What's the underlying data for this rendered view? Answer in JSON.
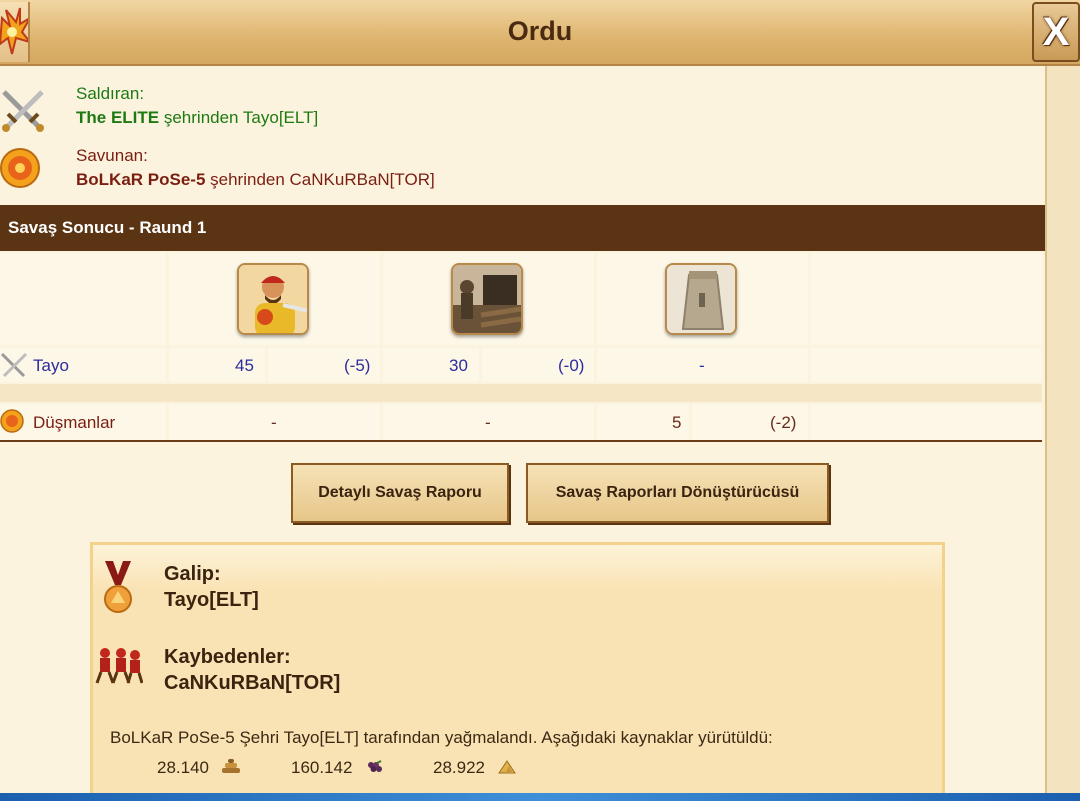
{
  "window": {
    "title": "Ordu",
    "close_label": "X"
  },
  "attacker": {
    "label": "Saldıran:",
    "city": "The ELITE",
    "from_text": " şehrinden Tayo[ELT]"
  },
  "defender": {
    "label": "Savunan:",
    "city": "BoLKaR PoSe-5",
    "from_text": " şehrinden CaNKuRBaN[TOR]"
  },
  "battle": {
    "section_title": "Savaş Sonucu - Raund 1",
    "units": [
      {
        "icon": "slinger-unit-icon"
      },
      {
        "icon": "catapult-unit-icon"
      },
      {
        "icon": "wall-tower-icon"
      }
    ],
    "rows": [
      {
        "name": "Tayo",
        "icon": "crossed-swords-icon",
        "unit1": {
          "count": "45",
          "loss": "(-5)"
        },
        "unit2": {
          "count": "30",
          "loss": "(-0)"
        },
        "unit3": {
          "count": "-"
        }
      },
      {
        "name": "Düşmanlar",
        "icon": "shield-icon",
        "unit1": {
          "count": "-"
        },
        "unit2": {
          "count": "-"
        },
        "unit3": {
          "count": "5",
          "loss": "(-2)"
        }
      }
    ]
  },
  "buttons": {
    "detailed_report": "Detaylı Savaş Raporu",
    "report_converter": "Savaş Raporları Dönüştürücüsü"
  },
  "result": {
    "winner_label": "Galip:",
    "winner_name": "Tayo[ELT]",
    "losers_label": "Kaybedenler:",
    "losers_name": "CaNKuRBaN[TOR]",
    "plunder_text": "BoLKaR PoSe-5 Şehri Tayo[ELT] tarafından yağmalandı. Aşağıdaki kaynaklar yürütüldü:",
    "resources": [
      {
        "amount": "28.140",
        "icon": "wood-icon"
      },
      {
        "amount": "160.142",
        "icon": "wine-grapes-icon"
      },
      {
        "amount": "28.922",
        "icon": "marble-icon"
      }
    ]
  },
  "colors": {
    "attacker_green": "#1d7a12",
    "defender_red": "#7b1e12",
    "header_brown": "#5a3413",
    "count_blue": "#2c2c9c"
  }
}
